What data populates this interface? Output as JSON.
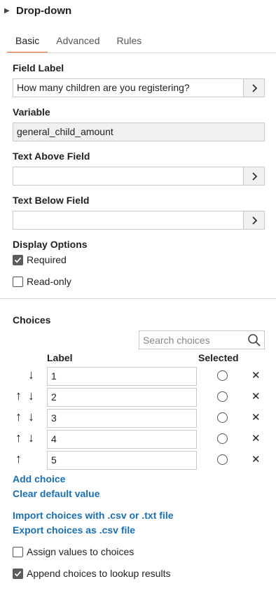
{
  "panel": {
    "title": "Drop-down",
    "caret_icon": "triangle-right"
  },
  "tabs": [
    {
      "label": "Basic",
      "active": true
    },
    {
      "label": "Advanced",
      "active": false
    },
    {
      "label": "Rules",
      "active": false
    }
  ],
  "fields": {
    "field_label": {
      "label": "Field Label",
      "value": "How many children are you registering?"
    },
    "variable": {
      "label": "Variable",
      "value": "general_child_amount"
    },
    "text_above": {
      "label": "Text Above Field",
      "value": ""
    },
    "text_below": {
      "label": "Text Below Field",
      "value": ""
    }
  },
  "display_options": {
    "title": "Display Options",
    "required": {
      "label": "Required",
      "checked": true
    },
    "read_only": {
      "label": "Read-only",
      "checked": false
    }
  },
  "choices": {
    "title": "Choices",
    "search_placeholder": "Search choices",
    "col_label": "Label",
    "col_selected": "Selected",
    "items": [
      {
        "label": "1",
        "up": false,
        "down": true,
        "selected": false
      },
      {
        "label": "2",
        "up": true,
        "down": true,
        "selected": false
      },
      {
        "label": "3",
        "up": true,
        "down": true,
        "selected": false
      },
      {
        "label": "4",
        "up": true,
        "down": true,
        "selected": false
      },
      {
        "label": "5",
        "up": true,
        "down": false,
        "selected": false
      }
    ],
    "add_choice": "Add choice",
    "clear_default": "Clear default value",
    "import_label": "Import choices with .csv or .txt file",
    "export_label": "Export choices as .csv file",
    "assign_values": {
      "label": "Assign values to choices",
      "checked": false
    },
    "append_lookup": {
      "label": "Append choices to lookup results",
      "checked": true
    }
  },
  "colors": {
    "accent": "#e8692b",
    "link": "#1a6fb4"
  }
}
